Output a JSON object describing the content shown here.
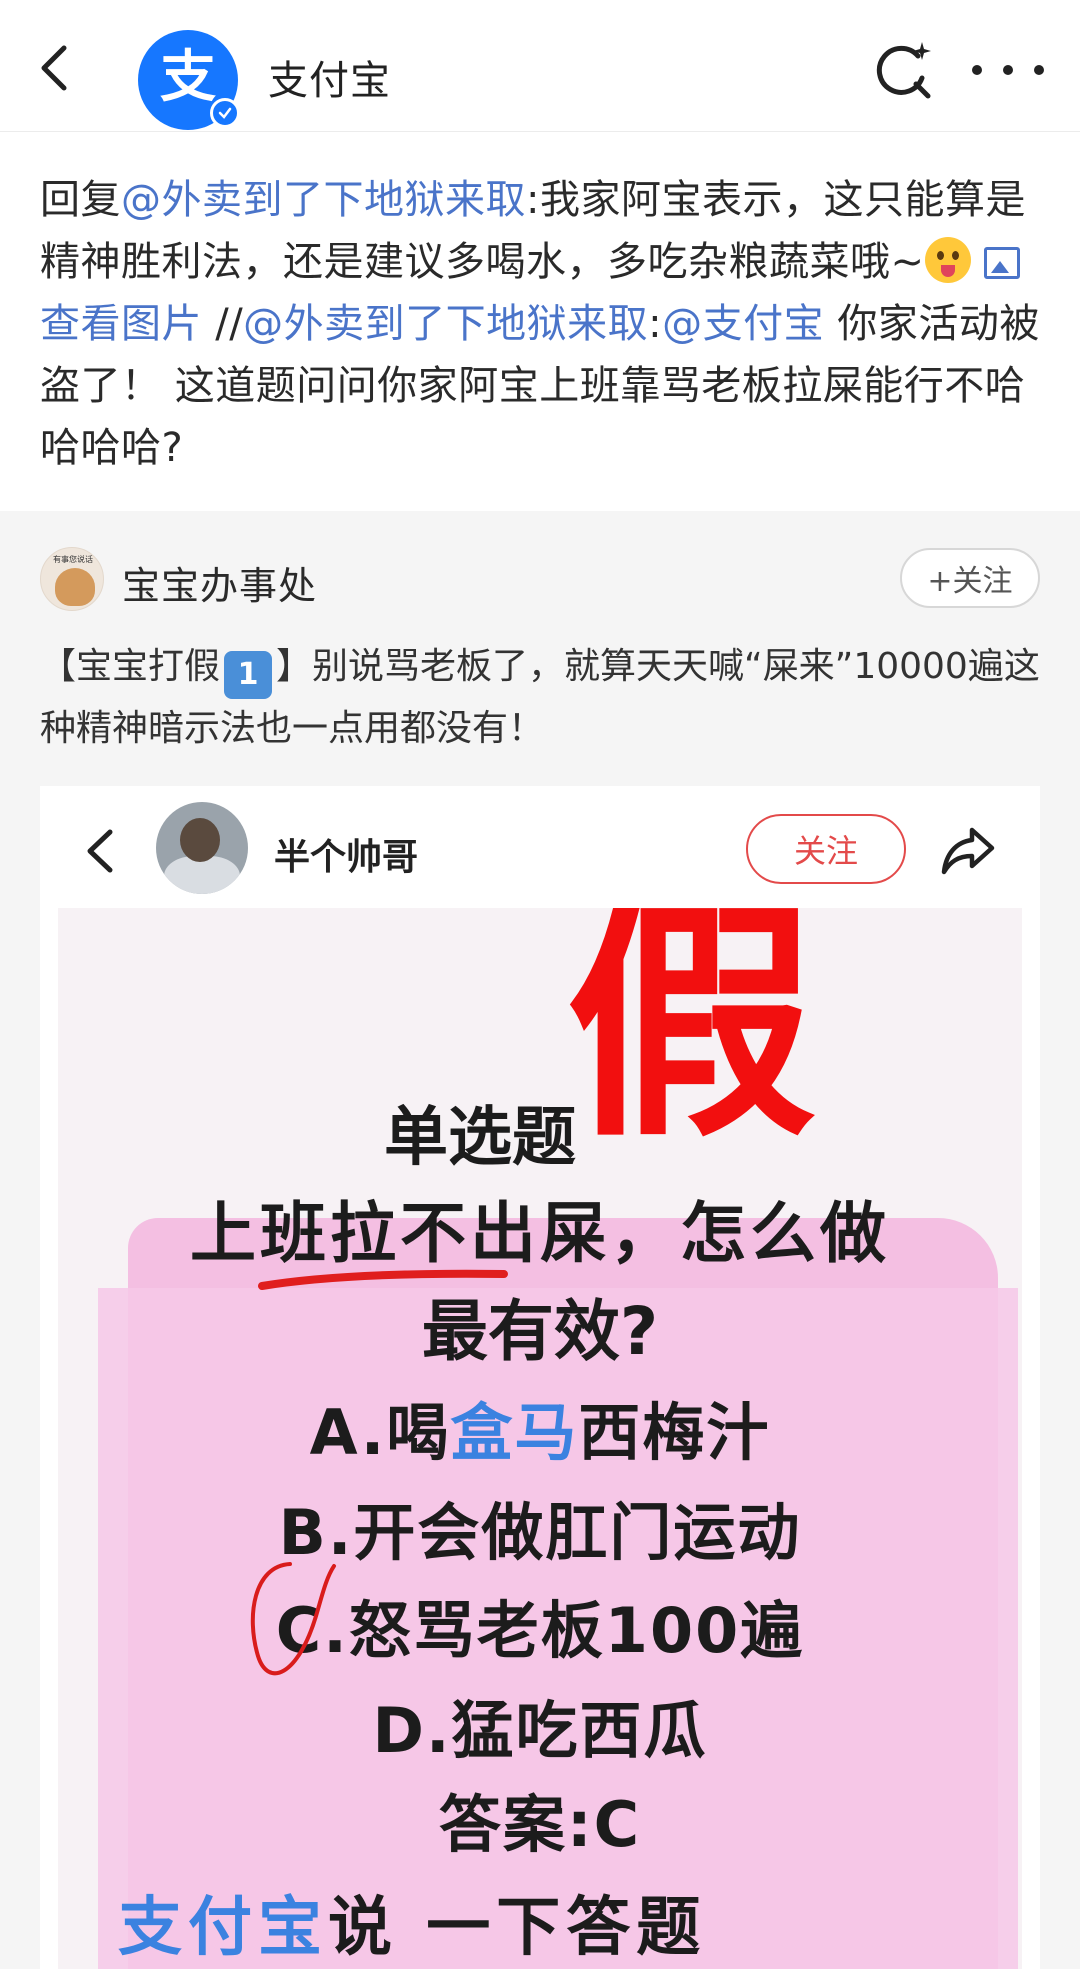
{
  "header": {
    "title": "支付宝",
    "avatar_glyph": "支"
  },
  "reply": {
    "prefix": "回复",
    "mention_1": "@外卖到了下地狱来取",
    "text_1": ":我家阿宝表示，这只能算是精神胜利法，还是建议多喝水，多吃杂粮蔬菜哦~",
    "view_image": "查看图片",
    "forward_sep": " //",
    "mention_2": "@外卖到了下地狱来取",
    "colon": ":",
    "mention_3": "@支付宝",
    "text_2": " 你家活动被盗了！ 这道题问问你家阿宝上班靠骂老板拉屎能行不哈哈哈哈?"
  },
  "repost": {
    "avatar_tag": "有事您说话",
    "author": "宝宝办事处",
    "follow_label": "+关注",
    "text_prefix": "【宝宝打假",
    "badge": "1",
    "text_suffix": "】别说骂老板了，就算天天喊“屎来”10000遍这种精神暗示法也一点用都没有！"
  },
  "embedded": {
    "author": "半个帅哥",
    "follow_label": "关注",
    "stamp": "假",
    "title_1": "单选题",
    "title_2": "上班拉不出屎，怎么做",
    "title_3": "最有效?",
    "option_a_prefix": "A.喝",
    "option_a_brand": "盒马",
    "option_a_suffix": "西梅汁",
    "option_b": "B.开会做肛门运动",
    "option_c": "C.怒骂老板100遍",
    "option_d": "D.猛吃西瓜",
    "answer": "答案:C",
    "cut_blue": "支付宝",
    "cut_dark": "说 一下答题"
  },
  "colors": {
    "link": "#4a74c9",
    "brand_blue": "#1677ff",
    "stamp_red": "#f20f0f",
    "follow_red": "#e34a4a"
  },
  "icons": [
    "back-arrow-icon",
    "search-sparkle-icon",
    "more-dots-icon",
    "verified-icon",
    "image-icon",
    "share-icon"
  ]
}
